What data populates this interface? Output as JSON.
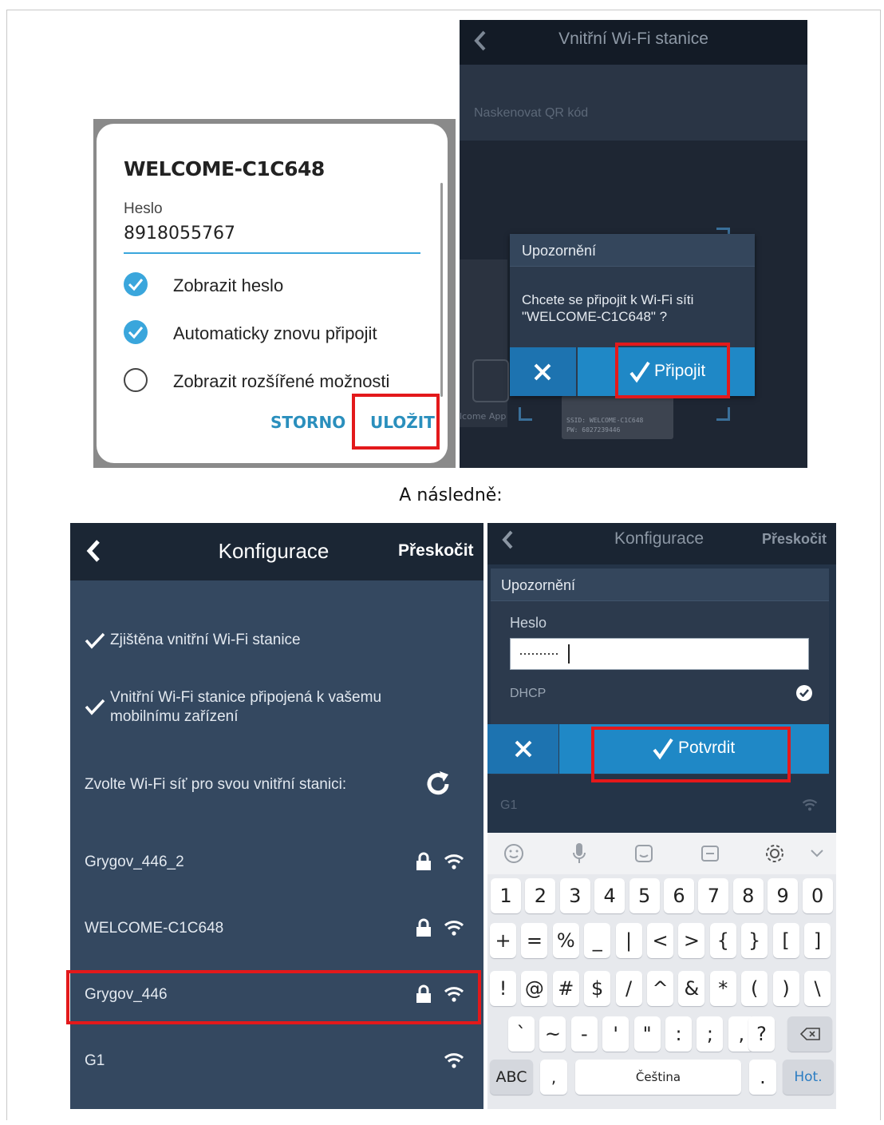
{
  "colors": {
    "accent": "#3aa6dc",
    "header": "#1b2634",
    "panel": "#344860",
    "confirm_bar": "#1f88c6",
    "highlight": "#e3191b"
  },
  "dialog1": {
    "title": "WELCOME-C1C648",
    "password_label": "Heslo",
    "password_value": "8918055767",
    "options": [
      {
        "label": "Zobrazit heslo",
        "checked": true
      },
      {
        "label": "Automaticky znovu připojit",
        "checked": true
      },
      {
        "label": "Zobrazit rozšířené možnosti",
        "checked": false
      }
    ],
    "cancel": "STORNO",
    "save": "ULOŽIT"
  },
  "screen2": {
    "title": "Vnitřní Wi-Fi stanice",
    "scan_text": "Naskenovat QR kód",
    "label_fragment": "lcome App",
    "ssid_text": "SSID: WELCOME-C1C648",
    "pw_text": "PW: 6027239446",
    "alert_title": "Upozornění",
    "alert_msg_line1": "Chcete se připojit k Wi-Fi síti",
    "alert_msg_line2": "\"WELCOME-C1C648\" ?",
    "connect": "Připojit"
  },
  "caption": "A následně:",
  "screen3": {
    "title": "Konfigurace",
    "skip": "Přeskočit",
    "status1": "Zjištěna vnitřní Wi-Fi stanice",
    "status2_line1": "Vnitřní Wi-Fi stanice připojená k vašemu",
    "status2_line2": "mobilnímu zařízení",
    "choose": "Zvolte Wi-Fi síť pro svou vnitřní stanici:",
    "networks": [
      {
        "name": "Grygov_446_2",
        "locked": true
      },
      {
        "name": "WELCOME-C1C648",
        "locked": true
      },
      {
        "name": "Grygov_446",
        "locked": true
      },
      {
        "name": "G1",
        "locked": false
      }
    ]
  },
  "screen4": {
    "title": "Konfigurace",
    "skip": "Přeskočit",
    "alert_title": "Upozornění",
    "password_label": "Heslo",
    "password_masked": "··········",
    "dhcp": "DHCP",
    "confirm": "Potvrdit",
    "bg_network": "G1",
    "keyboard": {
      "row1": [
        "1",
        "2",
        "3",
        "4",
        "5",
        "6",
        "7",
        "8",
        "9",
        "0"
      ],
      "row2": [
        "+",
        "=",
        "%",
        "_",
        "|",
        "<",
        ">",
        "{",
        "}",
        "[",
        "]"
      ],
      "row3": [
        "!",
        "@",
        "#",
        "$",
        "/",
        "^",
        "&",
        "*",
        "(",
        ")",
        "\\"
      ],
      "row4": [
        "`",
        "~",
        "-",
        "'",
        "\"",
        ":",
        ";",
        ","
      ],
      "row4_extra": "?",
      "abc": "ABC",
      "comma": ",",
      "space": "Čeština",
      "period": ".",
      "done": "Hot."
    }
  }
}
